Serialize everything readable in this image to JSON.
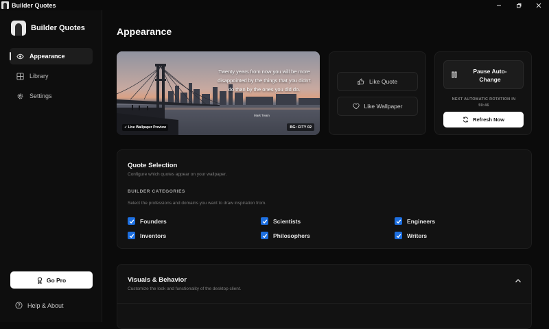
{
  "window": {
    "title": "Builder Quotes"
  },
  "sidebar": {
    "brand": "Builder Quotes",
    "items": [
      {
        "label": "Appearance",
        "icon": "eye-icon",
        "active": true
      },
      {
        "label": "Library",
        "icon": "grid-icon",
        "active": false
      },
      {
        "label": "Settings",
        "icon": "gear-icon",
        "active": false
      }
    ],
    "go_pro": "Go Pro",
    "help": "Help & About"
  },
  "main": {
    "title": "Appearance",
    "preview": {
      "quote": "Twenty years from now you will be more disappointed by the things that you didn't do than by the ones you did do.",
      "author": "Mark Twain",
      "live_label": "✓ Live Wallpaper Preview",
      "bg_label": "BG: CITY 02"
    },
    "actions": {
      "like_quote": "Like Quote",
      "like_wallpaper": "Like Wallpaper"
    },
    "rotation": {
      "pause_label": "Pause Auto-Change",
      "next_label": "NEXT AUTOMATIC ROTATION IN",
      "countdown": "59:46",
      "refresh_label": "Refresh Now"
    },
    "quote_selection": {
      "title": "Quote Selection",
      "subtitle": "Configure which quotes appear on your wallpaper.",
      "categories_heading": "BUILDER CATEGORIES",
      "categories_desc": "Select the professions and domains you want to draw inspiration from.",
      "categories": [
        {
          "label": "Founders",
          "checked": true
        },
        {
          "label": "Scientists",
          "checked": true
        },
        {
          "label": "Engineers",
          "checked": true
        },
        {
          "label": "Inventors",
          "checked": true
        },
        {
          "label": "Philosophers",
          "checked": true
        },
        {
          "label": "Writers",
          "checked": true
        }
      ]
    },
    "visuals": {
      "title": "Visuals & Behavior",
      "subtitle": "Customize the look and functionality of the desktop client."
    }
  },
  "colors": {
    "accent": "#1d6fe0",
    "background": "#0b0b0b",
    "card": "#121212"
  }
}
